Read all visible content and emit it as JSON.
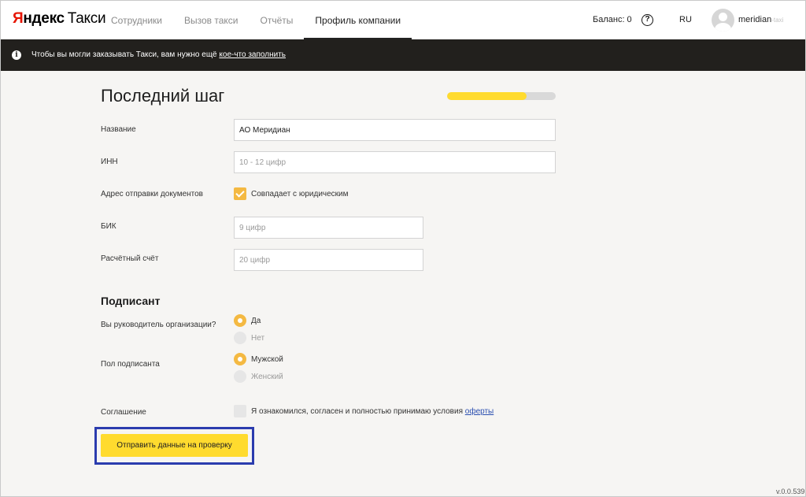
{
  "header": {
    "logo_ya_first": "Я",
    "logo_ya_rest": "ндекс",
    "logo_taxi": "Такси",
    "nav": [
      {
        "label": "Сотрудники"
      },
      {
        "label": "Вызов такси"
      },
      {
        "label": "Отчёты"
      },
      {
        "label": "Профиль компании",
        "active": true
      }
    ],
    "balance": "Баланс: 0",
    "help_glyph": "?",
    "lang": "RU",
    "username": "meridian",
    "username_faded": "-taxi"
  },
  "notice": {
    "info_glyph": "i",
    "text": "Чтобы вы могли заказывать Такси, вам нужно ещё ",
    "link": "кое-что заполнить"
  },
  "form": {
    "title": "Последний шаг",
    "progress_percent": 73,
    "name": {
      "label": "Название",
      "value": "АО Меридиан"
    },
    "inn": {
      "label": "ИНН",
      "placeholder": "10 - 12 цифр"
    },
    "address": {
      "label": "Адрес отправки документов",
      "checkbox_label": "Совпадает с юридическим",
      "checked": true
    },
    "bik": {
      "label": "БИК",
      "placeholder": "9 цифр"
    },
    "account": {
      "label": "Расчётный счёт",
      "placeholder": "20 цифр"
    },
    "signer_title": "Подписант",
    "is_head": {
      "label": "Вы руководитель организации?",
      "options": [
        "Да",
        "Нет"
      ],
      "selected": "Да"
    },
    "gender": {
      "label": "Пол подписанта",
      "options": [
        "Мужской",
        "Женский"
      ],
      "selected": "Мужской"
    },
    "agreement": {
      "label": "Соглашение",
      "text": "Я ознакомился, согласен и полностью принимаю условия ",
      "link": "оферты",
      "checked": false
    },
    "submit_label": "Отправить данные на проверку"
  },
  "footer": {
    "version": "v.0.0.539"
  },
  "colors": {
    "accent": "#ffdb2e",
    "checkbox": "#f4b942",
    "highlight_border": "#2b3cae",
    "notice_bg": "#22201d",
    "link": "#2b4fb0"
  }
}
